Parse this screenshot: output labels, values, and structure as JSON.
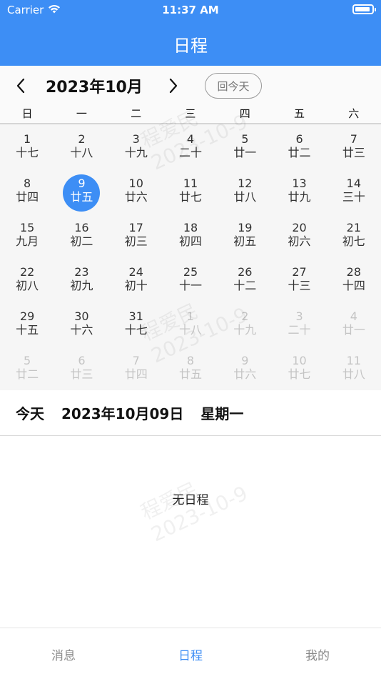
{
  "status": {
    "carrier": "Carrier",
    "time": "11:37 AM",
    "battery_level": 0.9
  },
  "nav": {
    "title": "日程"
  },
  "calendar": {
    "month_title": "2023年10月",
    "today_button": "回今天",
    "weekdays": [
      "日",
      "一",
      "二",
      "三",
      "四",
      "五",
      "六"
    ],
    "days": [
      {
        "d": "1",
        "l": "十七",
        "muted": false
      },
      {
        "d": "2",
        "l": "十八",
        "muted": false
      },
      {
        "d": "3",
        "l": "十九",
        "muted": false
      },
      {
        "d": "4",
        "l": "二十",
        "muted": false
      },
      {
        "d": "5",
        "l": "廿一",
        "muted": false
      },
      {
        "d": "6",
        "l": "廿二",
        "muted": false
      },
      {
        "d": "7",
        "l": "廿三",
        "muted": false
      },
      {
        "d": "8",
        "l": "廿四",
        "muted": false
      },
      {
        "d": "9",
        "l": "廿五",
        "muted": false,
        "selected": true
      },
      {
        "d": "10",
        "l": "廿六",
        "muted": false
      },
      {
        "d": "11",
        "l": "廿七",
        "muted": false
      },
      {
        "d": "12",
        "l": "廿八",
        "muted": false
      },
      {
        "d": "13",
        "l": "廿九",
        "muted": false
      },
      {
        "d": "14",
        "l": "三十",
        "muted": false
      },
      {
        "d": "15",
        "l": "九月",
        "muted": false
      },
      {
        "d": "16",
        "l": "初二",
        "muted": false
      },
      {
        "d": "17",
        "l": "初三",
        "muted": false
      },
      {
        "d": "18",
        "l": "初四",
        "muted": false
      },
      {
        "d": "19",
        "l": "初五",
        "muted": false
      },
      {
        "d": "20",
        "l": "初六",
        "muted": false
      },
      {
        "d": "21",
        "l": "初七",
        "muted": false
      },
      {
        "d": "22",
        "l": "初八",
        "muted": false
      },
      {
        "d": "23",
        "l": "初九",
        "muted": false
      },
      {
        "d": "24",
        "l": "初十",
        "muted": false
      },
      {
        "d": "25",
        "l": "十一",
        "muted": false
      },
      {
        "d": "26",
        "l": "十二",
        "muted": false
      },
      {
        "d": "27",
        "l": "十三",
        "muted": false
      },
      {
        "d": "28",
        "l": "十四",
        "muted": false
      },
      {
        "d": "29",
        "l": "十五",
        "muted": false
      },
      {
        "d": "30",
        "l": "十六",
        "muted": false
      },
      {
        "d": "31",
        "l": "十七",
        "muted": false
      },
      {
        "d": "1",
        "l": "十八",
        "muted": true
      },
      {
        "d": "2",
        "l": "十九",
        "muted": true
      },
      {
        "d": "3",
        "l": "二十",
        "muted": true
      },
      {
        "d": "4",
        "l": "廿一",
        "muted": true
      },
      {
        "d": "5",
        "l": "廿二",
        "muted": true
      },
      {
        "d": "6",
        "l": "廿三",
        "muted": true
      },
      {
        "d": "7",
        "l": "廿四",
        "muted": true
      },
      {
        "d": "8",
        "l": "廿五",
        "muted": true
      },
      {
        "d": "9",
        "l": "廿六",
        "muted": true
      },
      {
        "d": "10",
        "l": "廿七",
        "muted": true
      },
      {
        "d": "11",
        "l": "廿八",
        "muted": true
      }
    ]
  },
  "today_row": {
    "label": "今天",
    "date": "2023年10月09日",
    "weekday": "星期一"
  },
  "events": {
    "empty_text": "无日程"
  },
  "watermark": {
    "name": "程爱民",
    "date": "2023-10-9"
  },
  "tabs": [
    {
      "label": "消息",
      "active": false
    },
    {
      "label": "日程",
      "active": true
    },
    {
      "label": "我的",
      "active": false
    }
  ],
  "colors": {
    "accent": "#3d8ef5",
    "muted_text": "#c4c4c4"
  }
}
